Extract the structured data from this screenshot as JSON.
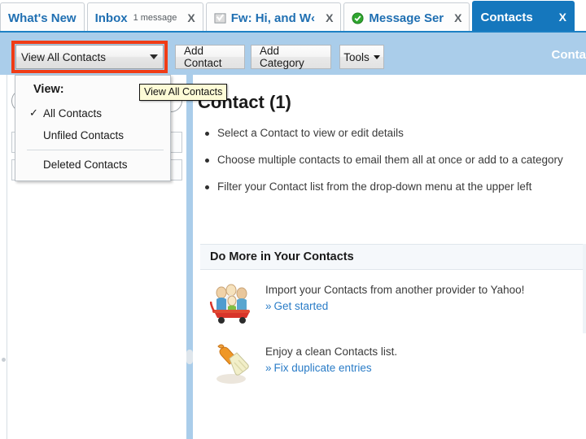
{
  "window": {
    "accent_blue": "#1577bd",
    "toolbar_band": "#aacdea",
    "highlight_red": "#f03c16",
    "link_blue": "#2a7cc7",
    "tooltip_bg": "#fdfbd6"
  },
  "tabs": [
    {
      "label": "What's New",
      "sub": "",
      "close": "",
      "icon": "",
      "active": false
    },
    {
      "label": "Inbox",
      "sub": "1 message",
      "close": "X",
      "icon": "",
      "active": false
    },
    {
      "label": "Fw: Hi, and W‹",
      "sub": "",
      "close": "X",
      "icon": "envelope-check-icon",
      "active": false
    },
    {
      "label": "Message Ser",
      "sub": "",
      "close": "X",
      "icon": "green-check-icon",
      "active": false
    },
    {
      "label": "Contacts",
      "sub": "",
      "close": "X",
      "icon": "",
      "active": true
    }
  ],
  "toolbar": {
    "view_selector_value": "View All Contacts",
    "add_contact_label": "Add Contact",
    "add_category_label": "Add Category",
    "tools_label": "Tools",
    "right_title": "Conta"
  },
  "tooltip": {
    "text": "View All Contacts"
  },
  "view_menu": {
    "title": "View:",
    "items": [
      {
        "label": "All Contacts",
        "checked": true
      },
      {
        "label": "Unfiled Contacts",
        "checked": false
      },
      {
        "label": "Deleted Contacts",
        "checked": false
      }
    ]
  },
  "sidebar": {
    "search_placeholder": "",
    "search_value": ""
  },
  "main": {
    "title": "Contact (1)",
    "bullets": [
      "Select a Contact to view or edit details",
      "Choose multiple contacts to email them all at once or add to a category",
      "Filter your Contact list from the drop-down menu at the upper left"
    ],
    "do_more_heading": "Do More in Your Contacts",
    "promos": [
      {
        "icon": "people-in-wagon-icon",
        "text": "Import your Contacts from another provider to Yahoo!",
        "link_chevron": "»",
        "link": "Get started"
      },
      {
        "icon": "broom-icon",
        "text": "Enjoy a clean Contacts list.",
        "link_chevron": "»",
        "link": "Fix duplicate entries"
      }
    ]
  }
}
